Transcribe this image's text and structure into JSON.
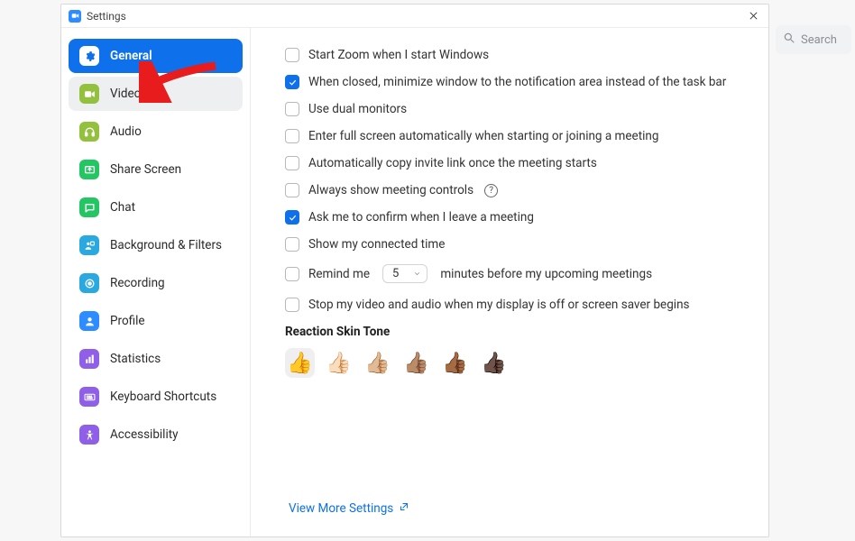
{
  "window": {
    "title": "Settings"
  },
  "backdrop": {
    "search_placeholder": "Search"
  },
  "sidebar": {
    "items": [
      {
        "label": "General",
        "icon": "gear",
        "bg": "#ffffff",
        "fg": "#0e71eb",
        "active_bg": "#ffffff"
      },
      {
        "label": "Video",
        "icon": "video",
        "bg": "#94c13d",
        "fg": "#ffffff"
      },
      {
        "label": "Audio",
        "icon": "headphones",
        "bg": "#94c13d",
        "fg": "#ffffff"
      },
      {
        "label": "Share Screen",
        "icon": "share",
        "bg": "#23c662",
        "fg": "#ffffff"
      },
      {
        "label": "Chat",
        "icon": "chat",
        "bg": "#23c662",
        "fg": "#ffffff"
      },
      {
        "label": "Background & Filters",
        "icon": "bgfilter",
        "bg": "#2aa9e0",
        "fg": "#ffffff"
      },
      {
        "label": "Recording",
        "icon": "record",
        "bg": "#2aa9e0",
        "fg": "#ffffff"
      },
      {
        "label": "Profile",
        "icon": "profile",
        "bg": "#2d8cff",
        "fg": "#ffffff"
      },
      {
        "label": "Statistics",
        "icon": "stats",
        "bg": "#8f5fe8",
        "fg": "#ffffff"
      },
      {
        "label": "Keyboard Shortcuts",
        "icon": "keyboard",
        "bg": "#8f5fe8",
        "fg": "#ffffff"
      },
      {
        "label": "Accessibility",
        "icon": "a11y",
        "bg": "#8f5fe8",
        "fg": "#ffffff"
      }
    ],
    "active_index": 0,
    "hover_index": 1
  },
  "general": {
    "options": [
      {
        "label": "Start Zoom when I start Windows",
        "checked": false
      },
      {
        "label": "When closed, minimize window to the notification area instead of the task bar",
        "checked": true
      },
      {
        "label": "Use dual monitors",
        "checked": false
      },
      {
        "label": "Enter full screen automatically when starting or joining a meeting",
        "checked": false
      },
      {
        "label": "Automatically copy invite link once the meeting starts",
        "checked": false
      },
      {
        "label": "Always show meeting controls",
        "checked": false,
        "has_info": true
      },
      {
        "label": "Ask me to confirm when I leave a meeting",
        "checked": true
      },
      {
        "label": "Show my connected time",
        "checked": false
      }
    ],
    "remind": {
      "prefix": "Remind me",
      "value": "5",
      "suffix": "minutes before my upcoming meetings",
      "checked": false
    },
    "stop_video": {
      "label": "Stop my video and audio when my display is off or screen saver begins",
      "checked": false
    },
    "skin_title": "Reaction Skin Tone",
    "skin_tones": [
      "👍",
      "👍🏻",
      "👍🏼",
      "👍🏽",
      "👍🏾",
      "👍🏿"
    ],
    "skin_selected": 0,
    "view_more": "View More Settings"
  }
}
